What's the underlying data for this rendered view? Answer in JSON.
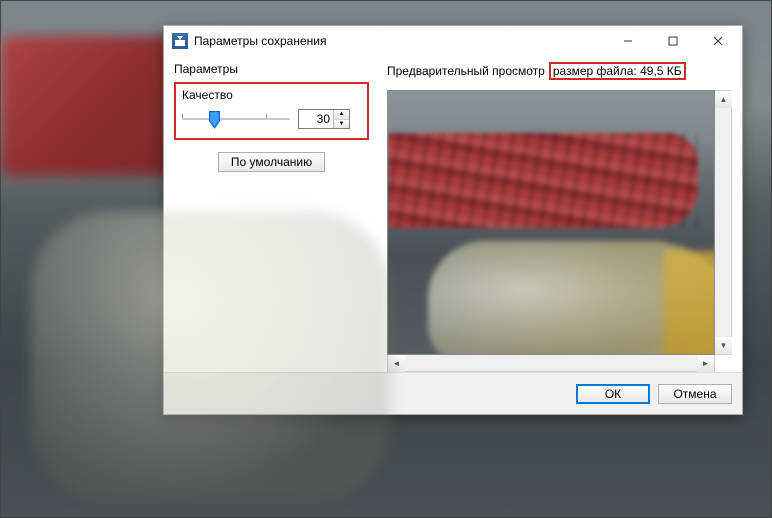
{
  "window": {
    "title": "Параметры сохранения"
  },
  "left": {
    "section_label": "Параметры",
    "quality_label": "Качество",
    "quality_value": "30",
    "quality_percent": 30,
    "default_button": "По умолчанию"
  },
  "right": {
    "preview_label": "Предварительный просмотр",
    "filesize_label": "размер файла: 49,5 КБ"
  },
  "footer": {
    "ok": "ОК",
    "cancel": "Отмена"
  },
  "highlight_color": "#cf2a2a"
}
